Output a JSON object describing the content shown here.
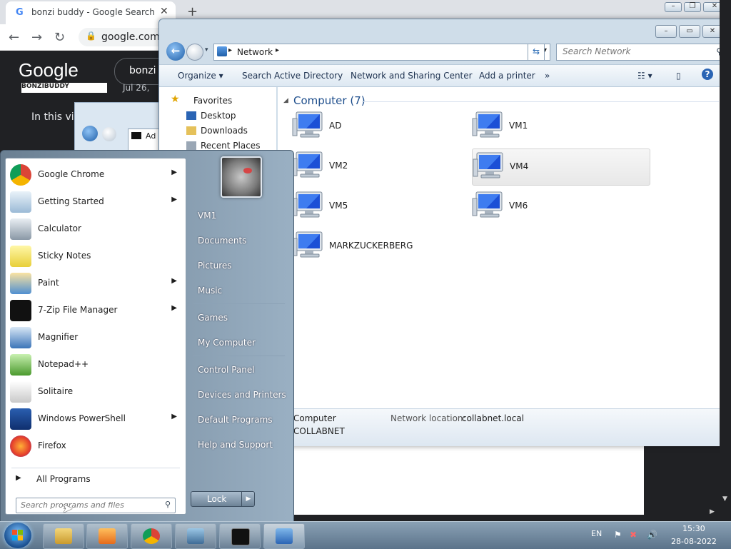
{
  "chrome": {
    "tab_title": "bonzi buddy - Google Search",
    "new_tab": "+",
    "url": "google.com/",
    "google_logo": "Google",
    "search_query": "bonzi b",
    "video_text": "In this vid",
    "thumb_label": "BONZIBUDDY",
    "thumb_date": "Jul 26,"
  },
  "mini_window": {
    "addr_text": "Ad"
  },
  "explorer": {
    "address": "Network",
    "search_placeholder": "Search Network",
    "toolbar": {
      "organize": "Organize",
      "search_ad": "Search Active Directory",
      "network_center": "Network and Sharing Center",
      "add_printer": "Add a printer",
      "more": "»"
    },
    "nav": {
      "favorites": "Favorites",
      "desktop": "Desktop",
      "downloads": "Downloads",
      "recent": "Recent Places"
    },
    "group_title": "Computer (7)",
    "computers": [
      "AD",
      "VM1",
      "VM2",
      "VM4",
      "VM5",
      "VM6",
      "MARKZUCKERBERG"
    ],
    "selected": "VM4",
    "details": {
      "type": "Computer",
      "domain": "COLLABNET",
      "location_key": "Network location:",
      "location_value": "collabnet.local"
    }
  },
  "start_menu": {
    "programs": [
      {
        "label": "Google Chrome",
        "arrow": true
      },
      {
        "label": "Getting Started",
        "arrow": true
      },
      {
        "label": "Calculator",
        "arrow": false
      },
      {
        "label": "Sticky Notes",
        "arrow": false
      },
      {
        "label": "Paint",
        "arrow": true
      },
      {
        "label": "7-Zip File Manager",
        "arrow": true
      },
      {
        "label": "Magnifier",
        "arrow": false
      },
      {
        "label": "Notepad++",
        "arrow": false
      },
      {
        "label": "Solitaire",
        "arrow": false
      },
      {
        "label": "Windows PowerShell",
        "arrow": true
      },
      {
        "label": "Firefox",
        "arrow": false
      }
    ],
    "all_programs": "All Programs",
    "search_placeholder": "Search programs and files",
    "right": [
      "VM1",
      "Documents",
      "Pictures",
      "Music",
      "Games",
      "My Computer",
      "Control Panel",
      "Devices and Printers",
      "Default Programs",
      "Help and Support"
    ],
    "lock": "Lock"
  },
  "taskbar": {
    "lang": "EN",
    "time": "15:30",
    "date": "28-08-2022"
  }
}
